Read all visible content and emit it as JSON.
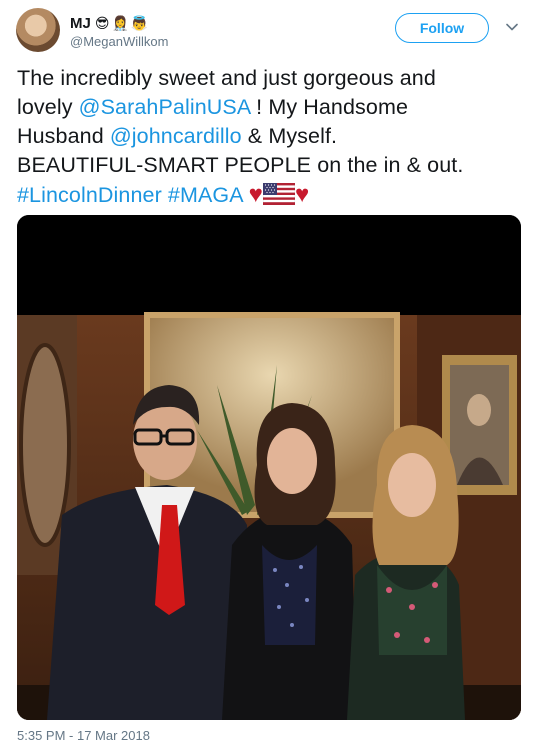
{
  "user": {
    "display_name": "MJ",
    "emojis": [
      "😎",
      "👩‍⚕️",
      "👼"
    ],
    "handle": "@MeganWillkom"
  },
  "actions": {
    "follow_label": "Follow"
  },
  "icons": {
    "more_menu": "chevron-down-icon",
    "flag": "us-flag-icon",
    "heart": "red-heart-icon"
  },
  "tweet": {
    "line1": "The incredibly sweet and just gorgeous and",
    "line2_prefix": "lovely ",
    "mention_palin": "@SarahPalinUSA",
    "line2_suffix": " ! My Handsome",
    "line3_prefix": "Husband ",
    "mention_cardillo": "@johncardillo",
    "line3_suffix": " & Myself.",
    "line4": "BEAUTIFUL-SMART PEOPLE on the in & out.",
    "hashtag_lincoln": "#LincolnDinner",
    "hashtag_maga": "#MAGA",
    "heart": "♥"
  },
  "timestamp": "5:35 PM - 17 Mar 2018",
  "colors": {
    "link": "#1b95e0",
    "follow": "#1da1f2",
    "muted": "#657786",
    "heart": "#c81a2e"
  }
}
